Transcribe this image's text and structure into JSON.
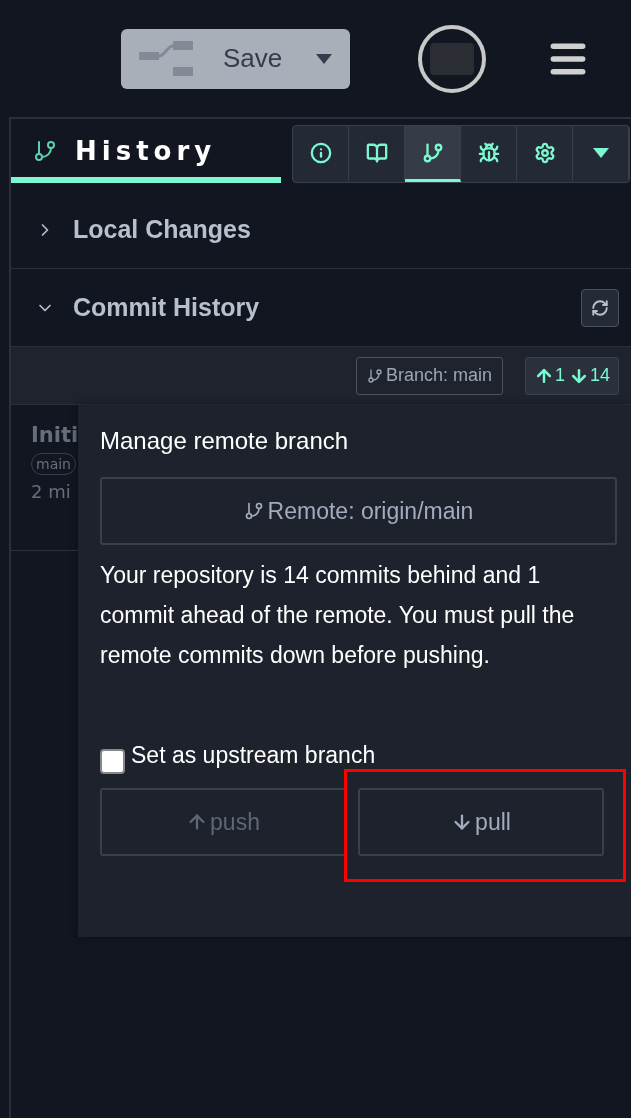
{
  "topbar": {
    "save_button": {
      "label": "Save",
      "disabled": true
    }
  },
  "panel": {
    "title": "History",
    "tabs": [
      {
        "kind": "info",
        "selected": false
      },
      {
        "kind": "book",
        "selected": false
      },
      {
        "kind": "branch",
        "selected": true
      },
      {
        "kind": "bug",
        "selected": false
      },
      {
        "kind": "gear",
        "selected": false
      },
      {
        "kind": "caret",
        "selected": false
      }
    ],
    "sections": [
      {
        "title": "Local Changes",
        "expanded": false
      },
      {
        "title": "Commit History",
        "expanded": true
      }
    ],
    "branch_bar": {
      "branch": "Branch: main",
      "ahead": "1",
      "behind": "14"
    },
    "commit": {
      "title": "Initi",
      "tag": "main",
      "time": "2 mi"
    }
  },
  "popover": {
    "title": "Manage remote branch",
    "remote": "Remote: origin/main",
    "message": "Your repository is 14 commits behind and 1 commit ahead of the remote. You must pull the remote commits down before pushing.",
    "upstream": {
      "label": "Set as upstream branch",
      "checked": false
    },
    "actions": [
      {
        "kind": "push",
        "label": "push",
        "disabled": true,
        "highlighted": false
      },
      {
        "kind": "pull",
        "label": "pull",
        "disabled": false,
        "highlighted": true
      }
    ]
  }
}
